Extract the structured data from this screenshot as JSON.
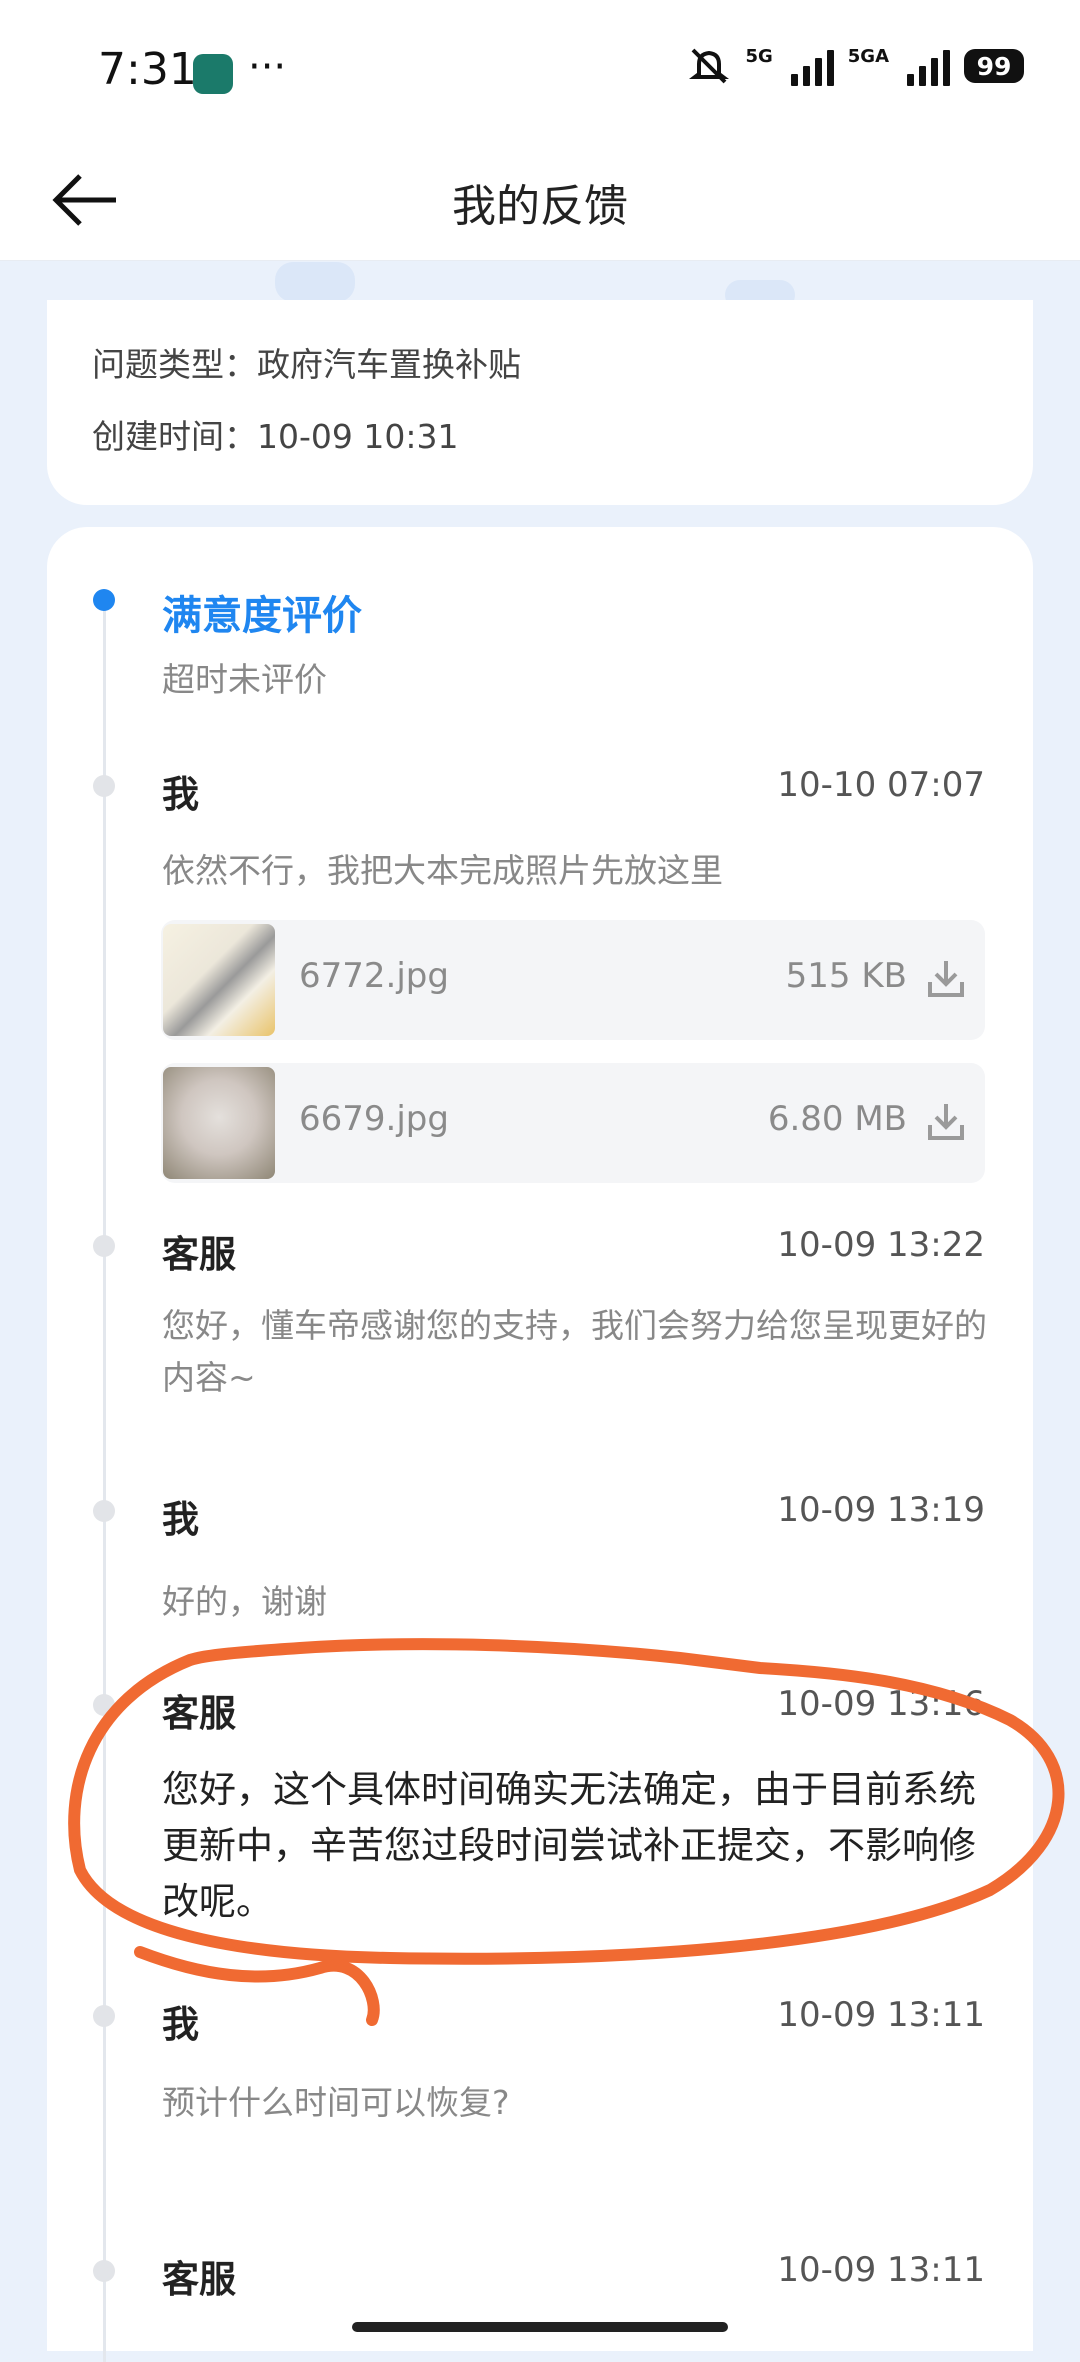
{
  "status_bar": {
    "time": "7:31",
    "dots": "···",
    "net1": "5G",
    "net2": "5GA",
    "battery": "99"
  },
  "header": {
    "title": "我的反馈"
  },
  "ticket": {
    "type_line": "问题类型：政府汽车置换补贴",
    "created_line": "创建时间：10-09 10:31"
  },
  "satisfaction": {
    "title": "满意度评价",
    "status": "超时未评价"
  },
  "timeline": [
    {
      "who": "我",
      "time": "10-10 07:07",
      "text": "依然不行，我把大本完成照片先放这里"
    },
    {
      "who": "客服",
      "time": "10-09 13:22",
      "text": "您好，懂车帝感谢您的支持，我们会努力给您呈现更好的内容~"
    },
    {
      "who": "我",
      "time": "10-09 13:19",
      "text": "好的，谢谢"
    },
    {
      "who": "客服",
      "time": "10-09 13:16",
      "text": "您好，这个具体时间确实无法确定，由于目前系统更新中，辛苦您过段时间尝试补正提交，不影响修改呢。"
    },
    {
      "who": "我",
      "time": "10-09 13:11",
      "text": "预计什么时间可以恢复?"
    },
    {
      "who": "客服",
      "time": "10-09 13:11"
    }
  ],
  "attachments": [
    {
      "name": "6772.jpg",
      "size": "515 KB"
    },
    {
      "name": "6679.jpg",
      "size": "6.80 MB"
    }
  ],
  "colors": {
    "accent": "#1f86f0",
    "annotation": "#f06a32"
  }
}
